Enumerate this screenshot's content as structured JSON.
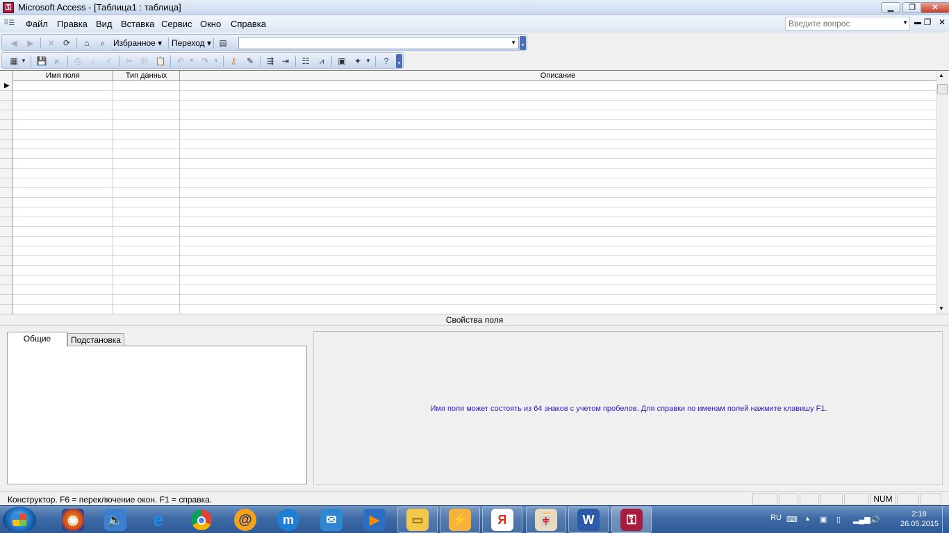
{
  "window": {
    "title": "Microsoft Access - [Таблица1 : таблица]",
    "app_icon": "access-key-icon"
  },
  "menu": {
    "items": [
      {
        "label": "Файл"
      },
      {
        "label": "Правка"
      },
      {
        "label": "Вид"
      },
      {
        "label": "Вставка"
      },
      {
        "label": "Сервис"
      },
      {
        "label": "Окно"
      },
      {
        "label": "Справка"
      }
    ],
    "help_placeholder": "Введите вопрос"
  },
  "web_toolbar": {
    "favorites_label": "Избранное",
    "goto_label": "Переход",
    "address_value": ""
  },
  "design_grid": {
    "columns": [
      "Имя поля",
      "Тип данных",
      "Описание"
    ],
    "rows": []
  },
  "field_properties": {
    "title": "Свойства поля",
    "tabs": [
      {
        "label": "Общие",
        "active": true
      },
      {
        "label": "Подстановка",
        "active": false
      }
    ],
    "hint": "Имя поля может состоять из 64 знаков с учетом пробелов.  Для справки по именам полей нажмите клавишу F1.",
    "hint_color": "#2a1fc2"
  },
  "status": {
    "text": "Конструктор.  F6 = переключение окон.  F1 = справка.",
    "num_indicator": "NUM"
  },
  "taskbar": {
    "language": "RU",
    "time": "2:18",
    "date": "26.05.2015"
  }
}
